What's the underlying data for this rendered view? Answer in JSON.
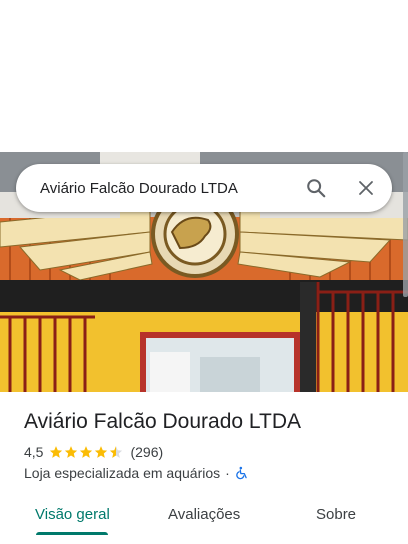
{
  "search": {
    "value": "Aviário Falcão Dourado LTDA",
    "search_icon": "search-icon",
    "close_icon": "close-icon"
  },
  "place": {
    "name": "Aviário Falcão Dourado LTDA",
    "rating": "4,5",
    "rating_value": 4.5,
    "reviews_count": "(296)",
    "category": "Loja especializada em aquários",
    "separator": "·",
    "accessibility_icon": "wheelchair-icon"
  },
  "tabs": [
    {
      "label": "Visão geral",
      "active": true
    },
    {
      "label": "Avaliações",
      "active": false
    },
    {
      "label": "Sobre",
      "active": false
    }
  ],
  "colors": {
    "accent": "#00796b",
    "star": "#fbbc04",
    "accessibility": "#1a73e8"
  }
}
